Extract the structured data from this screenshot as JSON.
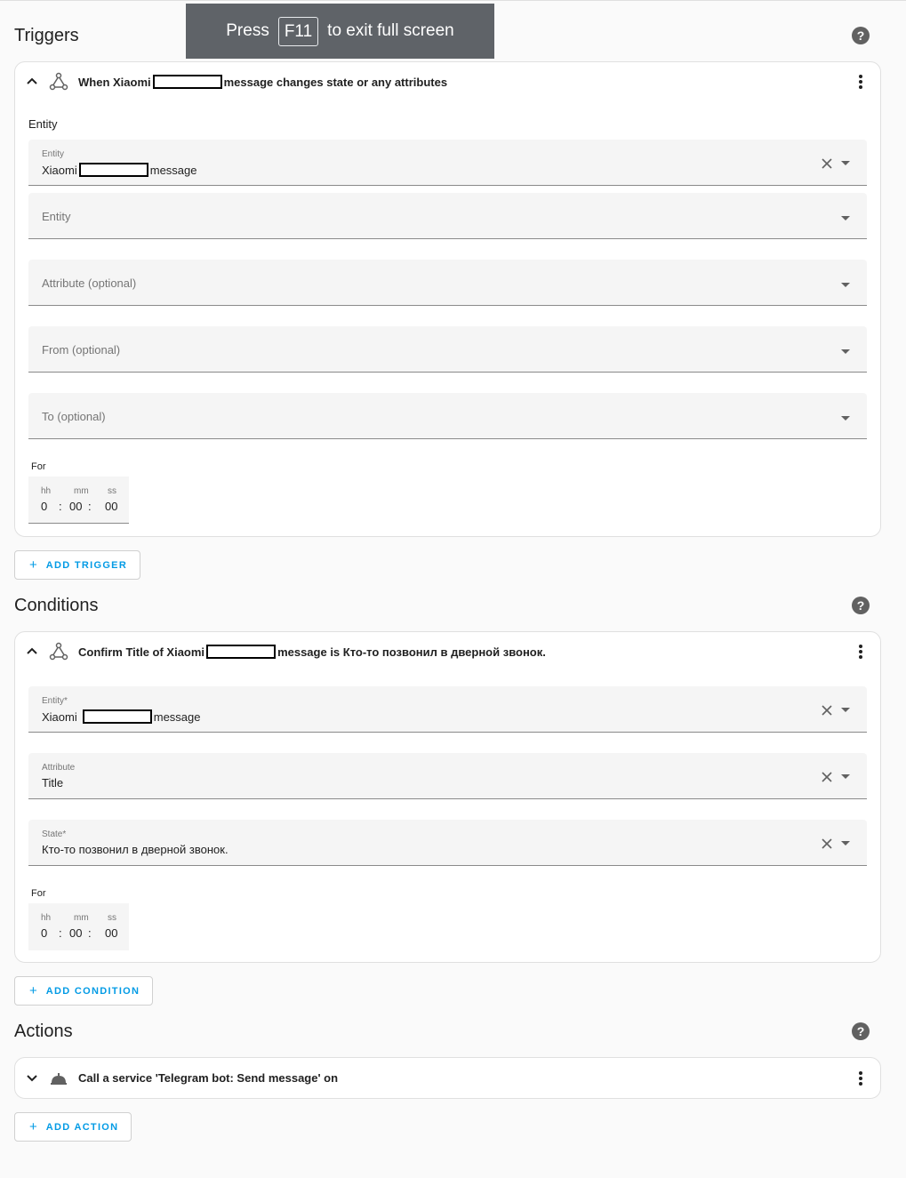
{
  "fullscreen_toast": {
    "press": "Press",
    "key": "F11",
    "suffix": "to exit full screen"
  },
  "triggers": {
    "title": "Triggers",
    "help_icon": "help-circle-icon",
    "card": {
      "header_prefix": "When Xiaomi",
      "header_suffix": "message changes state or any attributes",
      "entity_section_label": "Entity",
      "entity_field": {
        "label": "Entity",
        "value_prefix": "Xiaomi",
        "value_suffix": "message"
      },
      "entity_placeholder": "Entity",
      "attribute_placeholder": "Attribute (optional)",
      "from_placeholder": "From (optional)",
      "to_placeholder": "To (optional)",
      "for_label": "For",
      "duration": {
        "hh_label": "hh",
        "mm_label": "mm",
        "ss_label": "ss",
        "hh": "0",
        "mm": "00",
        "ss": "00"
      }
    },
    "add_label": "ADD TRIGGER"
  },
  "conditions": {
    "title": "Conditions",
    "help_icon": "help-circle-icon",
    "card": {
      "header_prefix": "Confirm Title of Xiaomi",
      "header_suffix": "message is Кто-то позвонил в дверной звонок.",
      "entity_field": {
        "label": "Entity*",
        "value_prefix": "Xiaomi",
        "value_suffix": "message"
      },
      "attribute_field": {
        "label": "Attribute",
        "value": "Title"
      },
      "state_field": {
        "label": "State*",
        "value": "Кто-то позвонил в дверной звонок."
      },
      "for_label": "For",
      "duration": {
        "hh_label": "hh",
        "mm_label": "mm",
        "ss_label": "ss",
        "hh": "0",
        "mm": "00",
        "ss": "00"
      }
    },
    "add_label": "ADD CONDITION"
  },
  "actions": {
    "title": "Actions",
    "help_icon": "help-circle-icon",
    "card": {
      "header": "Call a service 'Telegram bot: Send message' on"
    },
    "add_label": "ADD ACTION"
  },
  "colors": {
    "accent": "#039be5",
    "field_bg": "#f5f5f5",
    "card_border": "#e0e0e0",
    "page_bg": "#fafafa"
  }
}
